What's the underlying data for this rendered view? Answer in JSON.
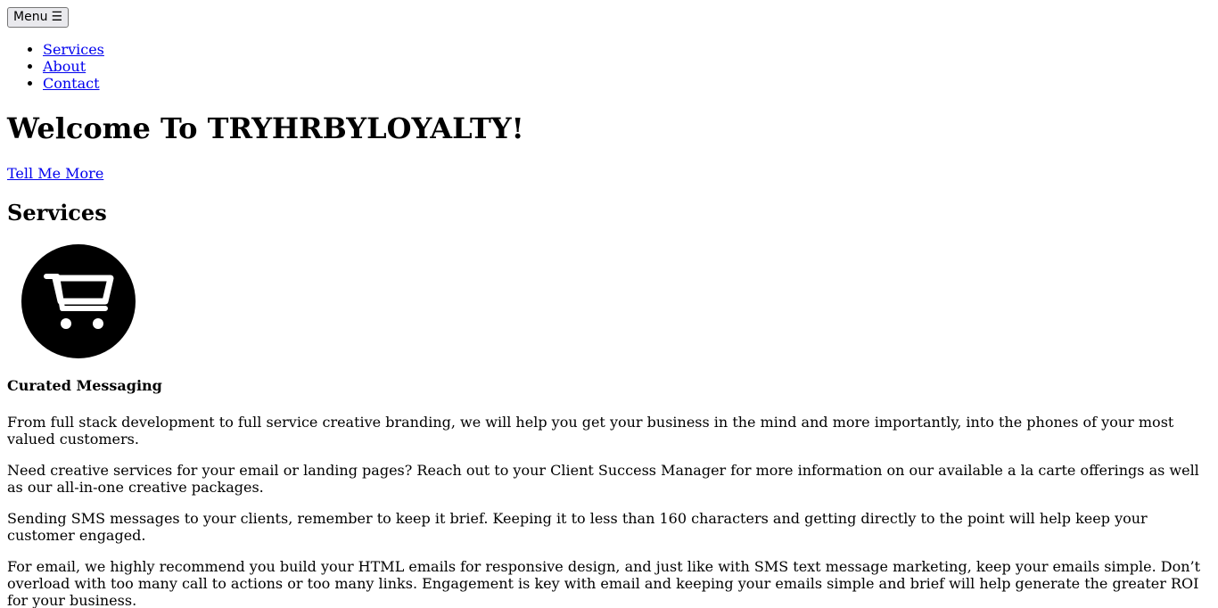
{
  "header": {
    "menu_label": "Menu",
    "menu_glyph": "☰"
  },
  "nav": {
    "items": [
      {
        "label": "Services"
      },
      {
        "label": "About"
      },
      {
        "label": "Contact"
      }
    ]
  },
  "hero": {
    "title": "Welcome To TRYHRBYLOYALTY!",
    "cta_label": "Tell Me More"
  },
  "services": {
    "heading": "Services",
    "icon": "shopping-cart-icon",
    "item_title": "Curated Messaging",
    "paragraphs": [
      "From full stack development to full service creative branding, we will help you get your business in the mind and more importantly, into the phones of your most valued customers.",
      "Need creative services for your email or landing pages? Reach out to your Client Success Manager for more information on our available a la carte offerings as well as our all-in-one creative packages.",
      "Sending SMS messages to your clients, remember to keep it brief. Keeping it to less than 160 characters and getting directly to the point will help keep your customer engaged.",
      "For email, we highly recommend you build your HTML emails for responsive design, and just like with SMS text message marketing, keep your emails simple. Don’t overload with too many call to actions or too many links. Engagement is key with email and keeping your emails simple and brief will help generate the greater ROI for your business."
    ]
  },
  "colors": {
    "link": "#0000ee",
    "text": "#000000",
    "background": "#ffffff",
    "icon_circle": "#000000",
    "icon_glyph": "#ffffff"
  }
}
